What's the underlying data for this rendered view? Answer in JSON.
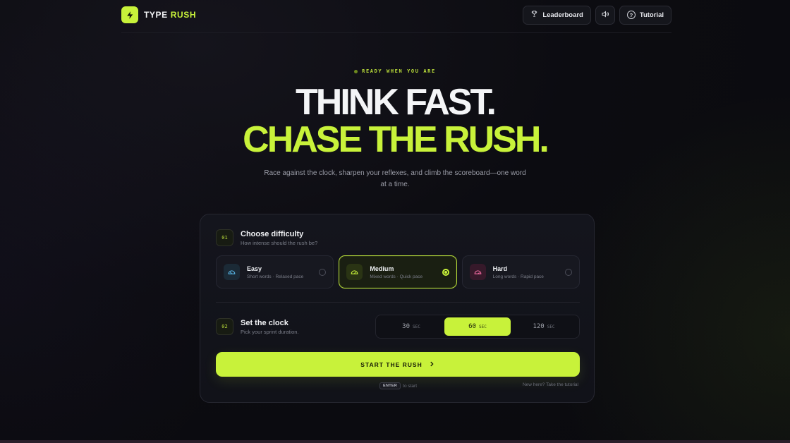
{
  "brand": {
    "name_main": "TYPE",
    "name_accent": "RUSH"
  },
  "nav": {
    "leaderboard_label": "Leaderboard",
    "tutorial_label": "Tutorial",
    "tutorial_icon_glyph": "?"
  },
  "hero": {
    "eyebrow": "READY WHEN YOU ARE",
    "headline_line1": "THINK FAST.",
    "headline_line2": "CHASE THE RUSH.",
    "subtitle": "Race against the clock, sharpen your reflexes, and climb the scoreboard—one word at a time."
  },
  "difficulty": {
    "step": "01",
    "title": "Choose difficulty",
    "subtitle": "How intense should the rush be?",
    "options": [
      {
        "name": "Easy",
        "desc": "Short words · Relaxed pace",
        "selected": false,
        "icon": "speedometer-low-icon",
        "color": "#59b6e6"
      },
      {
        "name": "Medium",
        "desc": "Mixed words · Quick pace",
        "selected": true,
        "icon": "speedometer-mid-icon",
        "color": "#c8f23a"
      },
      {
        "name": "Hard",
        "desc": "Long words · Rapid pace",
        "selected": false,
        "icon": "speedometer-high-icon",
        "color": "#ef6aa0"
      }
    ]
  },
  "clock": {
    "step": "02",
    "title": "Set the clock",
    "subtitle": "Pick your sprint duration.",
    "options": [
      {
        "value": "30",
        "unit": "SEC",
        "selected": false
      },
      {
        "value": "60",
        "unit": "SEC",
        "selected": true
      },
      {
        "value": "120",
        "unit": "SEC",
        "selected": false
      }
    ]
  },
  "start": {
    "label": "START THE RUSH",
    "kbd": "ENTER",
    "kbd_hint": "to start",
    "tutorial_hint": "New here? Take the tutorial"
  },
  "colors": {
    "accent": "#c8f23a",
    "background": "#0b0b10",
    "card": "#13141b"
  }
}
